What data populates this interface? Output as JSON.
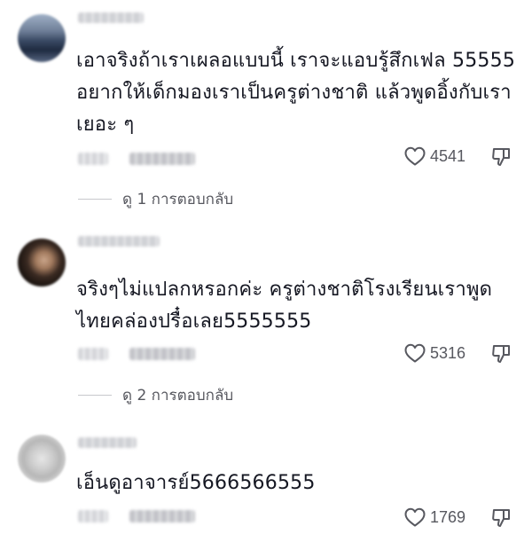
{
  "comments": [
    {
      "text": "เอาจริงถ้าเราเผลอแบบนี้ เราจะแอบรู้สึกเฟล 55555\nอยากให้เด็กมองเราเป็นครูต่างชาติ แล้วพูดอิ้งกับเรา\nเยอะ ๆ",
      "likes": "4541",
      "view_replies": "ดู 1 การตอบกลับ"
    },
    {
      "text": "จริงๆไม่แปลกหรอกค่ะ ครูต่างชาติโรงเรียนเราพูด\nไทยคล่องปรื๋อเลย5555555",
      "likes": "5316",
      "view_replies": "ดู 2 การตอบกลับ"
    },
    {
      "text": "เอ็นดูอาจารย์5666566555",
      "likes": "1769"
    }
  ],
  "icons": {
    "like": "heart-outline-icon",
    "dislike": "thumbs-down-outline-icon"
  },
  "colors": {
    "text": "#161823",
    "secondary": "#57585f"
  }
}
